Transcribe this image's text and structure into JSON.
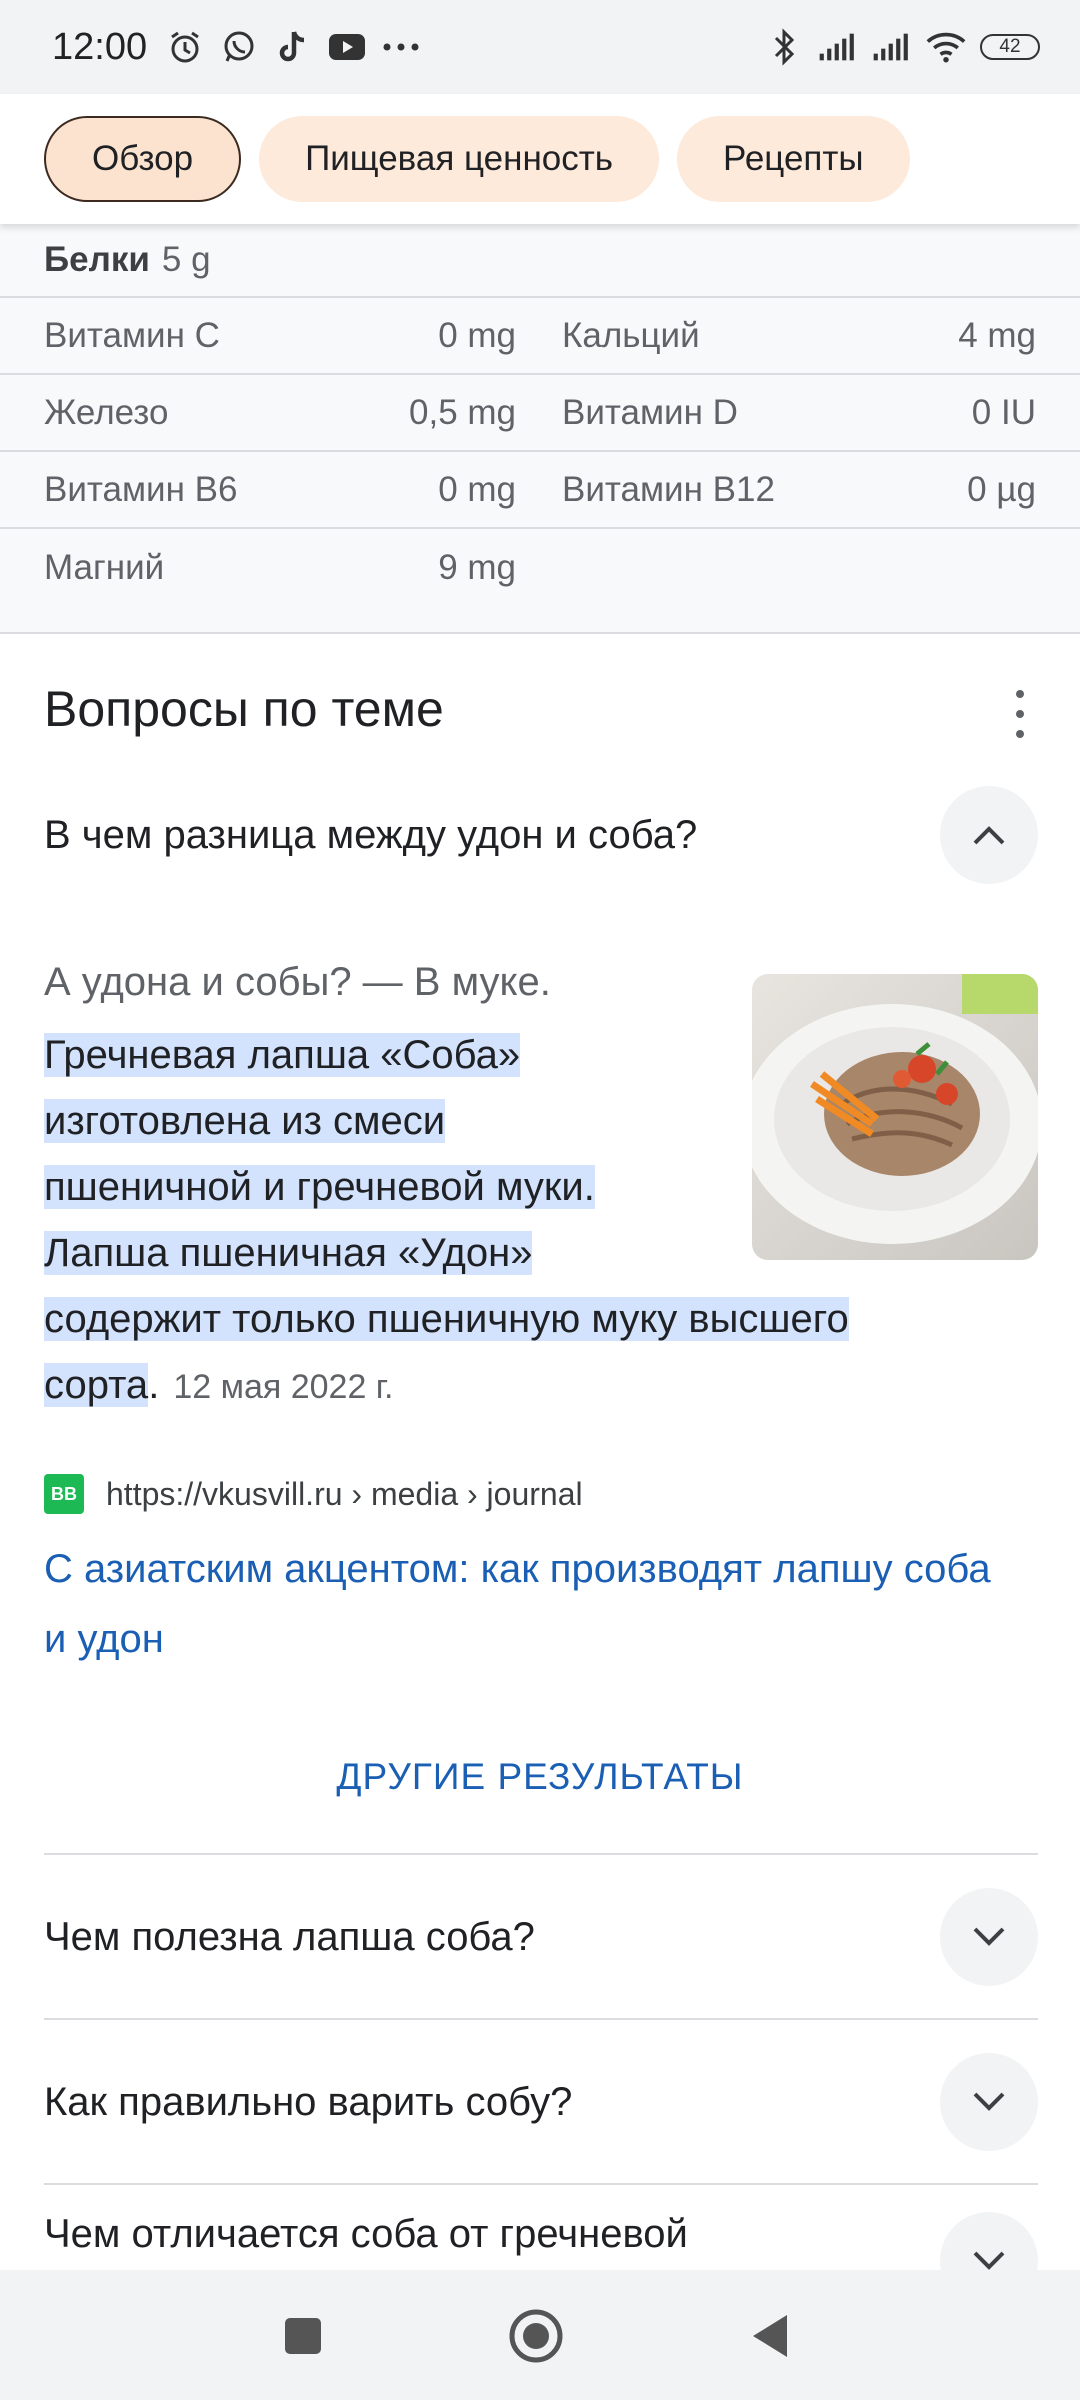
{
  "status_bar": {
    "time": "12:00",
    "battery": "42",
    "icons_left": [
      "alarm-icon",
      "whatsapp-icon",
      "tiktok-icon",
      "youtube-icon",
      "more-dots-icon"
    ],
    "icons_right": [
      "bluetooth-icon",
      "signal-icon",
      "signal-icon",
      "wifi-icon",
      "battery-icon"
    ]
  },
  "tabs": [
    {
      "label": "Обзор",
      "active": true
    },
    {
      "label": "Пищевая ценность",
      "active": false
    },
    {
      "label": "Рецепты",
      "active": false
    }
  ],
  "nutrition": {
    "protein": {
      "label": "Белки",
      "value": "5 g"
    },
    "rows": [
      {
        "left_label": "Витамин C",
        "left_value": "0 mg",
        "right_label": "Кальций",
        "right_value": "4 mg"
      },
      {
        "left_label": "Железо",
        "left_value": "0,5 mg",
        "right_label": "Витамин D",
        "right_value": "0 IU"
      },
      {
        "left_label": "Витамин B6",
        "left_value": "0 mg",
        "right_label": "Витамин B12",
        "right_value": "0 µg"
      },
      {
        "left_label": "Магний",
        "left_value": "9 mg",
        "right_label": "",
        "right_value": ""
      }
    ]
  },
  "questions": {
    "title": "Вопросы по теме",
    "expanded": {
      "question": "В чем разница между удон и соба?",
      "intro": "А удона и собы? — В муке.",
      "lines": [
        "Гречневая лапша «Соба»",
        "изготовлена из смеси",
        "пшеничной и гречневой муки.",
        "Лапша пшеничная «Удон»",
        "содержит только пшеничную муку высшего",
        "сорта"
      ],
      "tail": ".",
      "date": "12 мая 2022 г.",
      "source_url": "https://vkusvill.ru › media › journal",
      "favicon_text": "BB",
      "link_title": "С азиатским акцентом: как производят лапшу соба и удон"
    },
    "more_results": "ДРУГИЕ РЕЗУЛЬТАТЫ",
    "collapsed": [
      "Чем полезна лапша соба?",
      "Как правильно варить собу?",
      "Чем отличается соба от гречневой"
    ]
  },
  "colors": {
    "chip_bg": "#fdeadb",
    "highlight": "#d3e3fd",
    "link": "#1a5fb4"
  }
}
